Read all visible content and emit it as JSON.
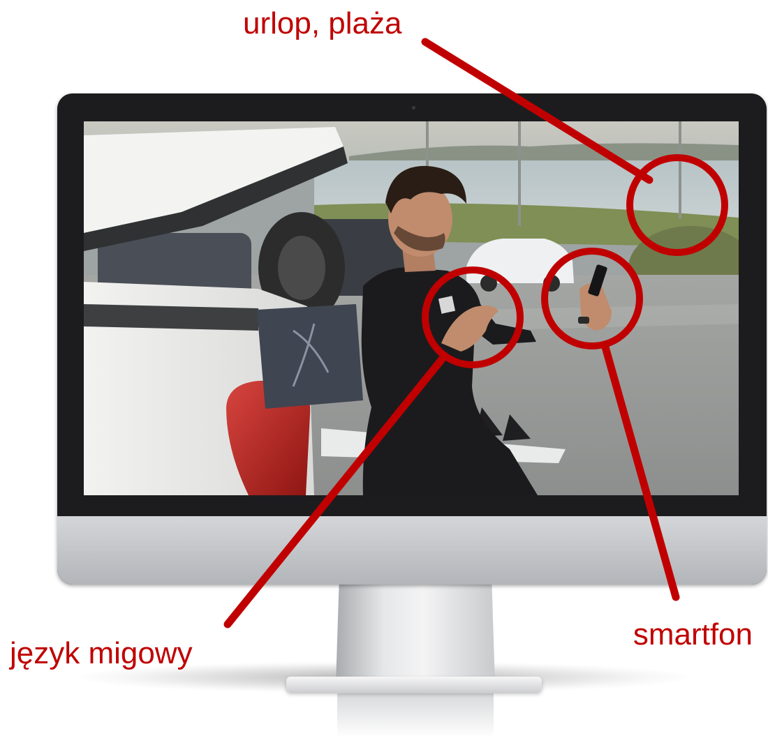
{
  "labels": {
    "top": "urlop, plaża",
    "right": "smartfon",
    "left": "język migowy"
  },
  "colors": {
    "annotation": "#c00000",
    "monitor_bezel": "#1c1c1e",
    "monitor_chin": "#c4c6c9"
  },
  "icons": {
    "camera": "webcam-dot-icon"
  }
}
